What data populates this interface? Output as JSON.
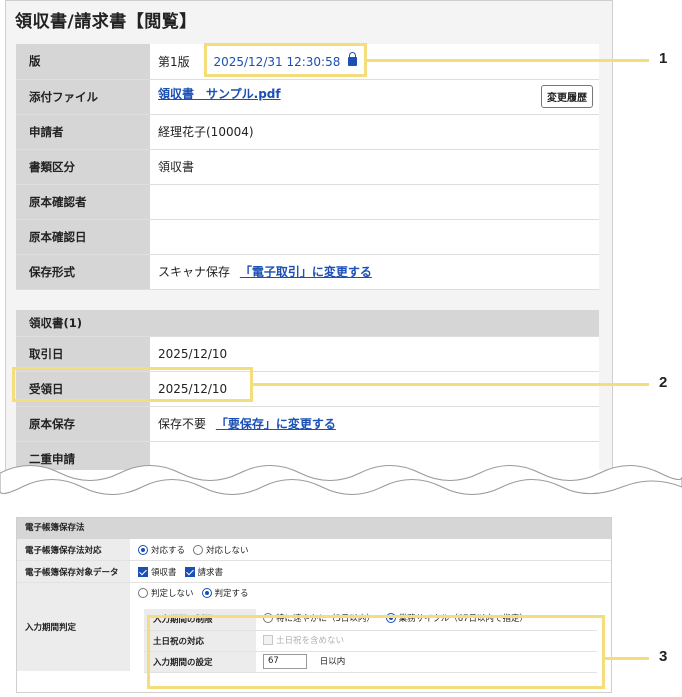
{
  "header": {
    "title": "領収書/請求書【閲覧】"
  },
  "doc_info": {
    "version_label": "版",
    "version_value": "第1版",
    "timestamp": "2025/12/31 12:30:58",
    "attachment_label": "添付ファイル",
    "attachment_file": "領収書　サンプル.pdf",
    "history_button": "変更履歴",
    "applicant_label": "申請者",
    "applicant_value": "経理花子(10004)",
    "doc_type_label": "書類区分",
    "doc_type_value": "領収書",
    "original_checker_label": "原本確認者",
    "original_check_date_label": "原本確認日",
    "storage_label": "保存形式",
    "storage_value": "スキャナ保存",
    "storage_link": "「電子取引」に変更する"
  },
  "receipt": {
    "section": "領収書(1)",
    "trade_date_label": "取引日",
    "trade_date_value": "2025/12/10",
    "receipt_date_label": "受領日",
    "receipt_date_value": "2025/12/10",
    "original_label": "原本保存",
    "original_value": "保存不要",
    "original_link": "「要保存」に変更する",
    "double_label": "二重申請"
  },
  "ebook": {
    "section": "電子帳簿保存法",
    "support_label": "電子帳簿保存法対応",
    "support_options": [
      "対応する",
      "対応しない"
    ],
    "target_label": "電子帳簿保存対象データ",
    "target_options": [
      "領収書",
      "請求書"
    ],
    "period_label": "入力期間判定",
    "judge_options": [
      "判定しない",
      "判定する"
    ],
    "limit_label": "入力期間の制限",
    "limit_options": [
      "特に速やかに（3日以内）",
      "業務サイクル（67日以内で指定）"
    ],
    "holiday_label": "土日祝の対応",
    "holiday_option": "土日祝を含めない",
    "setting_label": "入力期間の設定",
    "setting_value": "67",
    "setting_unit": "日以内"
  },
  "callouts": [
    "1",
    "2",
    "3"
  ],
  "colors": {
    "highlight": "#f5dc7d",
    "link": "#1a4fb5",
    "label_bg": "#d6d6d6"
  }
}
